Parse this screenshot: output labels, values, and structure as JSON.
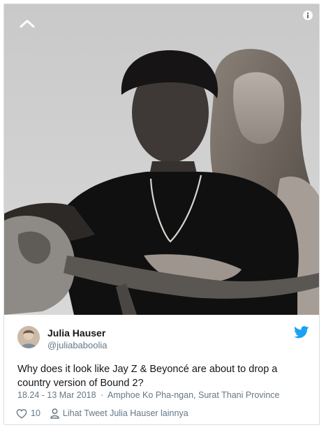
{
  "tweet": {
    "author_name": "Julia Hauser",
    "author_handle": "@juliababoolia",
    "text": "Why does it look like Jay Z & Beyoncé are about to drop a country version of Bound 2?",
    "timestamp": "18.24 - 13 Mar 2018",
    "separator": "·",
    "location": "Amphoe Ko Pha-ngan, Surat Thani Province",
    "like_count": "10",
    "more_tweets_label": "Lihat Tweet Julia Hauser lainnya"
  },
  "icons": {
    "collapse": "chevron-up-icon",
    "info": "info-icon",
    "brand": "twitter-bird-icon",
    "like": "heart-icon",
    "profile": "person-icon"
  },
  "colors": {
    "twitter_blue": "#1da1f2",
    "secondary_text": "#657786",
    "primary_text": "#14171a"
  }
}
